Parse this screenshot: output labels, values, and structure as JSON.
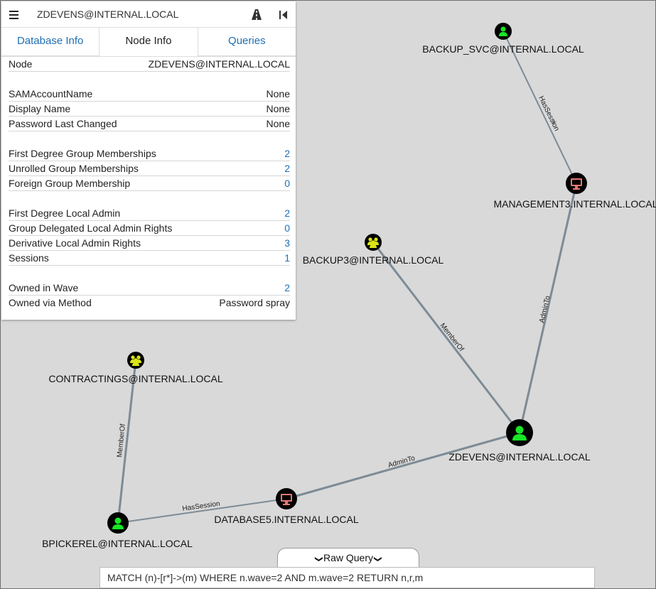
{
  "search": {
    "value": "ZDEVENS@INTERNAL.LOCAL",
    "menu_icon": "hamburger-icon",
    "path_icon": "road-path-icon",
    "collapse_icon": "collapse-left-icon"
  },
  "tabs": [
    {
      "label": "Database Info",
      "active": false
    },
    {
      "label": "Node Info",
      "active": true
    },
    {
      "label": "Queries",
      "active": false
    }
  ],
  "node_info": {
    "node": {
      "key": "Node",
      "value": "ZDEVENS@INTERNAL.LOCAL"
    },
    "basic": [
      {
        "key": "SAMAccountName",
        "value": "None"
      },
      {
        "key": "Display Name",
        "value": "None"
      },
      {
        "key": "Password Last Changed",
        "value": "None"
      }
    ],
    "groups": [
      {
        "key": "First Degree Group Memberships",
        "value": "2"
      },
      {
        "key": "Unrolled Group Memberships",
        "value": "2"
      },
      {
        "key": "Foreign Group Membership",
        "value": "0"
      }
    ],
    "admin": [
      {
        "key": "First Degree Local Admin",
        "value": "2"
      },
      {
        "key": "Group Delegated Local Admin Rights",
        "value": "0"
      },
      {
        "key": "Derivative Local Admin Rights",
        "value": "3"
      },
      {
        "key": "Sessions",
        "value": "1"
      }
    ],
    "owned": [
      {
        "key": "Owned in Wave",
        "value": "2"
      },
      {
        "key": "Owned via Method",
        "value": "Password spray"
      }
    ]
  },
  "graph": {
    "nodes": [
      {
        "id": "backup_svc",
        "label": "BACKUP_SVC@INTERNAL.LOCAL",
        "type": "user",
        "icon": "user-icon"
      },
      {
        "id": "management3",
        "label": "MANAGEMENT3.INTERNAL.LOCAL",
        "type": "computer",
        "icon": "computer-icon"
      },
      {
        "id": "backup3",
        "label": "BACKUP3@INTERNAL.LOCAL",
        "type": "group",
        "icon": "group-icon"
      },
      {
        "id": "zdevens",
        "label": "ZDEVENS@INTERNAL.LOCAL",
        "type": "user",
        "icon": "user-icon"
      },
      {
        "id": "contractings",
        "label": "CONTRACTINGS@INTERNAL.LOCAL",
        "type": "group",
        "icon": "group-icon"
      },
      {
        "id": "database5",
        "label": "DATABASE5.INTERNAL.LOCAL",
        "type": "computer",
        "icon": "computer-icon"
      },
      {
        "id": "bpickerel",
        "label": "BPICKEREL@INTERNAL.LOCAL",
        "type": "user",
        "icon": "user-icon"
      }
    ],
    "edges": [
      {
        "from": "backup_svc",
        "to": "management3",
        "label": "HasSession"
      },
      {
        "from": "zdevens",
        "to": "management3",
        "label": "AdminTo"
      },
      {
        "from": "backup3",
        "to": "zdevens",
        "label": "MemberOf"
      },
      {
        "from": "database5",
        "to": "zdevens",
        "label": "AdminTo"
      },
      {
        "from": "bpickerel",
        "to": "database5",
        "label": "HasSession"
      },
      {
        "from": "bpickerel",
        "to": "contractings",
        "label": "MemberOf"
      }
    ],
    "colors": {
      "user": "#17e625",
      "group": "#dbe617",
      "computer": "#e67873",
      "edge": "#7d8b96"
    }
  },
  "raw_query": {
    "toggle_label": "Raw Query",
    "value": "MATCH (n)-[r*]->(m) WHERE n.wave=2 AND m.wave=2 RETURN n,r,m"
  }
}
